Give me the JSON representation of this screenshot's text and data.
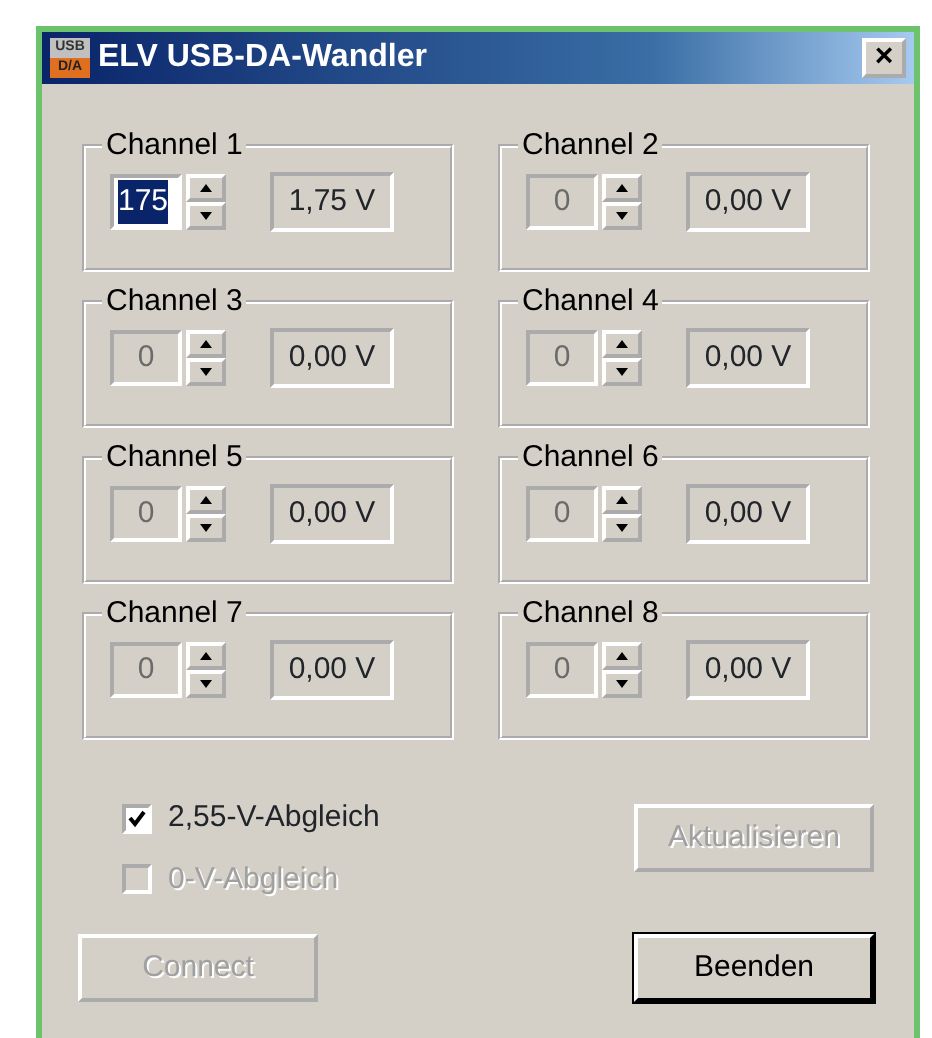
{
  "window": {
    "title": "ELV USB-DA-Wandler",
    "app_icon": {
      "top": "USB",
      "bottom": "D/A"
    },
    "close_label": "×"
  },
  "channels": [
    {
      "label": "Channel 1",
      "value": "175",
      "voltage": "1,75 V",
      "disabled": false,
      "selected": true
    },
    {
      "label": "Channel 2",
      "value": "0",
      "voltage": "0,00 V",
      "disabled": true,
      "selected": false
    },
    {
      "label": "Channel 3",
      "value": "0",
      "voltage": "0,00 V",
      "disabled": true,
      "selected": false
    },
    {
      "label": "Channel 4",
      "value": "0",
      "voltage": "0,00 V",
      "disabled": true,
      "selected": false
    },
    {
      "label": "Channel 5",
      "value": "0",
      "voltage": "0,00 V",
      "disabled": true,
      "selected": false
    },
    {
      "label": "Channel 6",
      "value": "0",
      "voltage": "0,00 V",
      "disabled": true,
      "selected": false
    },
    {
      "label": "Channel 7",
      "value": "0",
      "voltage": "0,00 V",
      "disabled": true,
      "selected": false
    },
    {
      "label": "Channel 8",
      "value": "0",
      "voltage": "0,00 V",
      "disabled": true,
      "selected": false
    }
  ],
  "checkboxes": [
    {
      "label": "2,55-V-Abgleich",
      "checked": true,
      "disabled": false
    },
    {
      "label": "0-V-Abgleich",
      "checked": false,
      "disabled": true
    }
  ],
  "buttons": {
    "update": {
      "label": "Aktualisieren",
      "disabled": true,
      "default": false
    },
    "connect": {
      "label": "Connect",
      "disabled": true,
      "default": false
    },
    "quit": {
      "label": "Beenden",
      "disabled": false,
      "default": true
    }
  }
}
